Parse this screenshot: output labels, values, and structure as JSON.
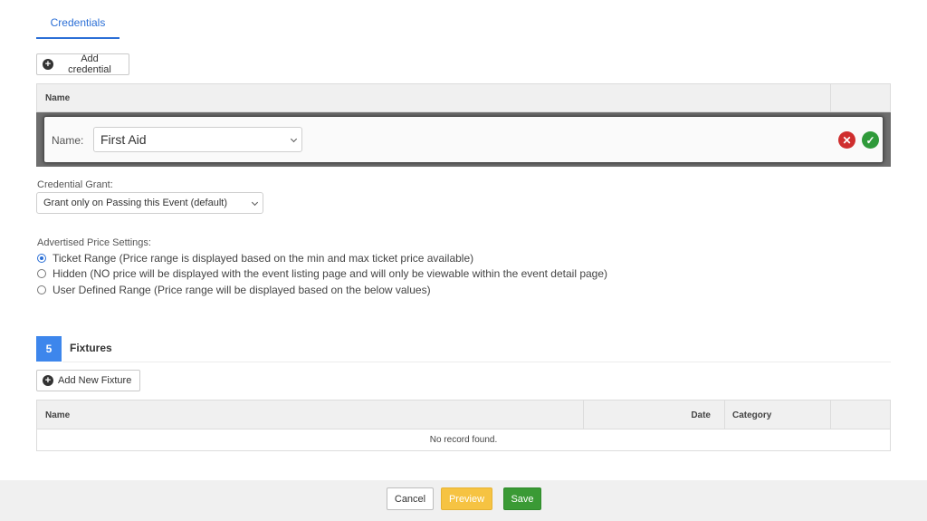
{
  "tabs": {
    "credentials": "Credentials"
  },
  "credentials": {
    "add_button": "Add credential",
    "table": {
      "name_header": "Name"
    },
    "edit_row": {
      "label": "Name:",
      "selected": "First Aid"
    }
  },
  "grant": {
    "label": "Credential Grant:",
    "selected": "Grant only on Passing this Event (default)"
  },
  "price_settings": {
    "label": "Advertised Price Settings:",
    "options": [
      {
        "label": "Ticket Range (Price range is displayed based on the min and max ticket price available)",
        "checked": true
      },
      {
        "label": "Hidden (NO price will be displayed with the event listing page and will only be viewable within the event detail page)",
        "checked": false
      },
      {
        "label": "User Defined Range (Price range will be displayed based on the below values)",
        "checked": false
      }
    ]
  },
  "fixtures": {
    "step_number": "5",
    "title": "Fixtures",
    "add_button": "Add New Fixture",
    "columns": {
      "name": "Name",
      "date": "Date",
      "category": "Category"
    },
    "empty_text": "No record found."
  },
  "footer": {
    "cancel": "Cancel",
    "preview": "Preview",
    "save": "Save"
  },
  "colors": {
    "accent": "#2b6fd6",
    "step_badge": "#3d86ec",
    "danger": "#cf2e2e",
    "success": "#2f9a3a",
    "preview": "#f6c342",
    "save": "#3a9a35"
  }
}
